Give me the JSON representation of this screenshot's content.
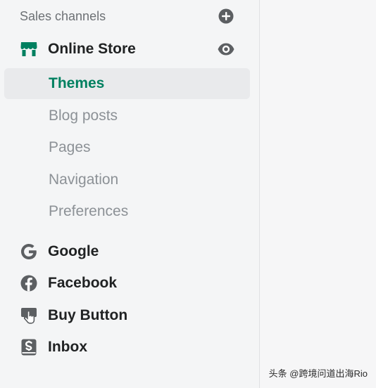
{
  "sidebar": {
    "section_title": "Sales channels",
    "online_store": {
      "label": "Online Store"
    },
    "sub_items": [
      {
        "label": "Themes",
        "active": true
      },
      {
        "label": "Blog posts",
        "active": false
      },
      {
        "label": "Pages",
        "active": false
      },
      {
        "label": "Navigation",
        "active": false
      },
      {
        "label": "Preferences",
        "active": false
      }
    ],
    "channels": [
      {
        "label": "Google",
        "icon": "google-icon"
      },
      {
        "label": "Facebook",
        "icon": "facebook-icon"
      },
      {
        "label": "Buy Button",
        "icon": "buy-button-icon"
      },
      {
        "label": "Inbox",
        "icon": "inbox-icon"
      }
    ]
  },
  "watermark": "头条 @跨境问道出海Rio",
  "colors": {
    "active_green": "#008060",
    "store_icon_green": "#008060",
    "icon_gray": "#5c5f62",
    "muted_text": "#8c9196",
    "active_bg": "#e9eaec"
  }
}
